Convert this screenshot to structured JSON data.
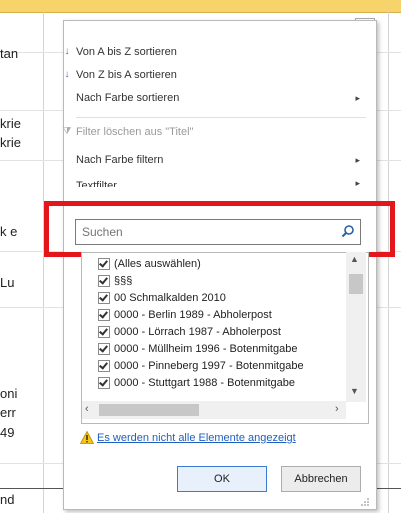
{
  "sheet": {
    "left_texts": [
      "tan",
      "krie",
      "krie",
      "k e",
      "Lu",
      "oni",
      "err",
      "49",
      "nd"
    ]
  },
  "menu": {
    "sort_az": "Von A bis Z sortieren",
    "sort_za": "Von Z bis A sortieren",
    "sort_color": "Nach Farbe sortieren",
    "clear_filter": "Filter löschen aus \"Titel\"",
    "filter_color": "Nach Farbe filtern",
    "text_filter": "Textfilter"
  },
  "search": {
    "placeholder": "Suchen"
  },
  "list": {
    "items": [
      "(Alles auswählen)",
      "§§§",
      "00 Schmalkalden 2010",
      "0000 - Berlin 1989 - Abholerpost",
      "0000 - Lörrach 1987 - Abholerpost",
      "0000 - Müllheim 1996 - Botenmitgabe",
      "0000 - Pinneberg 1997 - Botenmitgabe",
      "0000 - Stuttgart 1988 - Botenmitgabe"
    ]
  },
  "warning": {
    "text": "Es werden nicht alle Elemente angezeigt"
  },
  "buttons": {
    "ok": "OK",
    "cancel": "Abbrechen"
  },
  "icons": {
    "sort_az": "sort-ascending-icon",
    "sort_za": "sort-descending-icon",
    "clear_filter": "clear-filter-icon",
    "search": "magnifier-icon",
    "warning": "warning-triangle-icon"
  },
  "colors": {
    "highlight_frame": "#e3161b",
    "header_band": "#f6d36b",
    "link": "#1f5fbf"
  }
}
